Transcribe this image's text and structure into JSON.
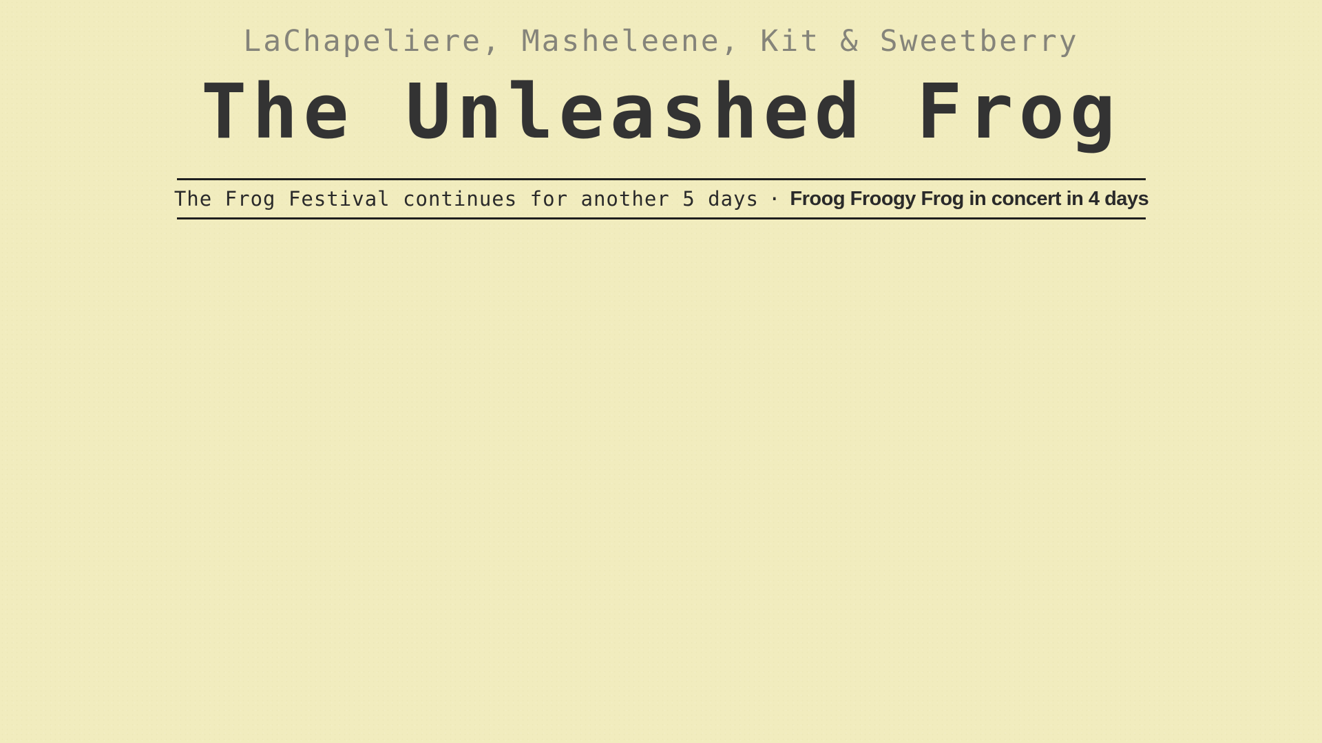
{
  "header": {
    "authors": "LaChapeliere, Masheleene, Kit & Sweetberry",
    "title": "The Unleashed Frog"
  },
  "ticker": {
    "festival": "The Frog Festival continues for another 5 days",
    "separator": "·",
    "concert": "Froog Froogy Frog in concert in 4 days"
  },
  "colors": {
    "background": "#f1ecbe",
    "authors_text": "#85847a",
    "title_text": "#333333",
    "rule": "#1e1e1e"
  }
}
